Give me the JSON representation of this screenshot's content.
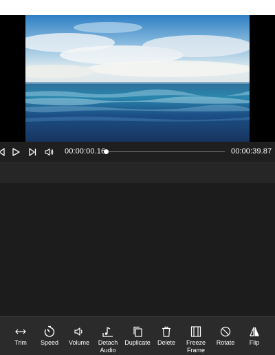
{
  "player": {
    "current_time": "00:00:00.16",
    "total_time": "00:00:39.87",
    "progress": 0.004
  },
  "player_controls": {
    "icons": [
      "skip-back-icon",
      "play-icon",
      "skip-forward-icon",
      "volume-icon"
    ]
  },
  "toolbar": {
    "tools": [
      {
        "label": "Trim",
        "icon": "trim-icon"
      },
      {
        "label": "Speed",
        "icon": "speed-icon"
      },
      {
        "label": "Volume",
        "icon": "volume-icon"
      },
      {
        "label": "Detach\nAudio",
        "icon": "detach-audio-icon"
      },
      {
        "label": "Duplicate",
        "icon": "duplicate-icon"
      },
      {
        "label": "Delete",
        "icon": "delete-icon"
      },
      {
        "label": "Freeze\nFrame",
        "icon": "freeze-frame-icon"
      },
      {
        "label": "Rotate",
        "icon": "rotate-icon"
      },
      {
        "label": "Flip",
        "icon": "flip-icon"
      }
    ]
  },
  "colors": {
    "app_background": "#1a1a1a",
    "toolbar_background": "#2b2b2b",
    "text": "#ffffff"
  }
}
